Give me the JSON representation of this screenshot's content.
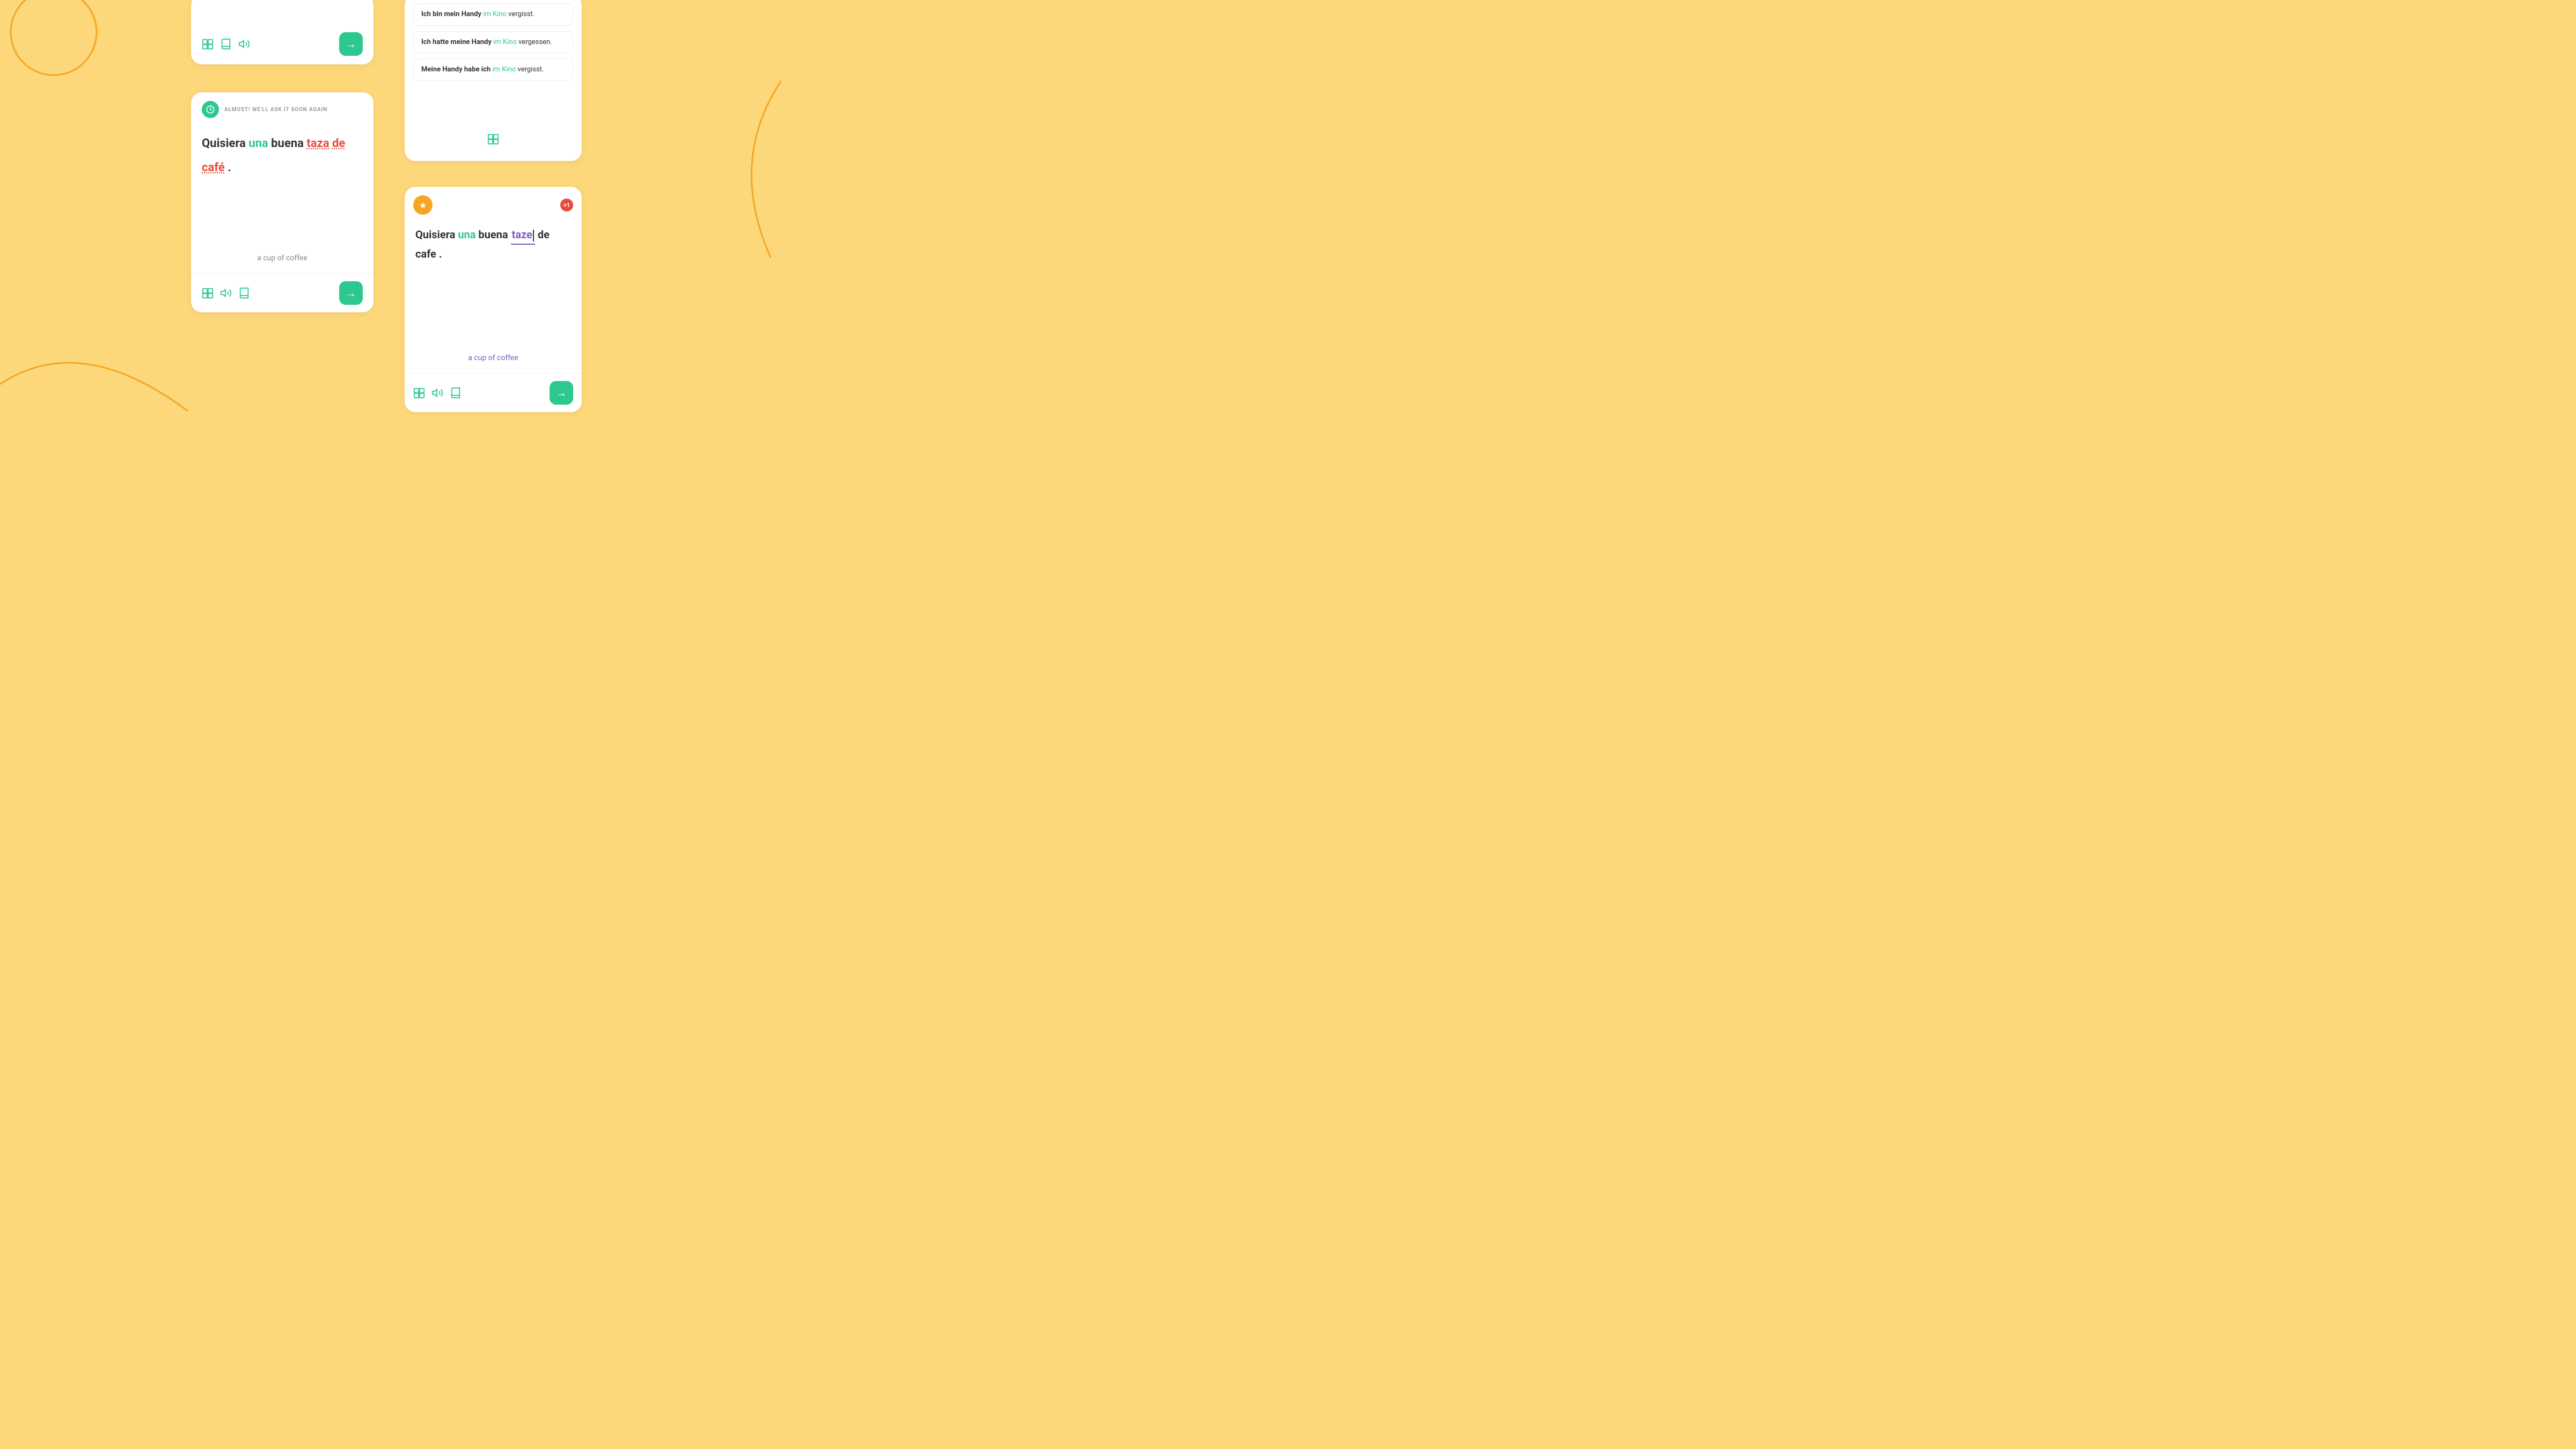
{
  "background_color": "#FDD87A",
  "accent_color": "#F5A623",
  "green_color": "#2DC88F",
  "red_color": "#E74C3C",
  "purple_color": "#7C5CBF",
  "card_top_left": {
    "footer_icons": [
      "translate-icon",
      "volume-icon",
      "book-icon"
    ],
    "arrow_label": "→"
  },
  "card_mid_left": {
    "banner_text": "ALMOST! WE'LL ASK IT SOON AGAIN",
    "sentence_parts": [
      {
        "text": "Quisiera",
        "style": "normal"
      },
      {
        "text": "una",
        "style": "green"
      },
      {
        "text": "buena",
        "style": "normal"
      },
      {
        "text": "taza",
        "style": "red-underline"
      },
      {
        "text": "de",
        "style": "red-underline"
      },
      {
        "text": "café",
        "style": "red-underline"
      },
      {
        "text": ".",
        "style": "normal"
      }
    ],
    "translation": "a cup of coffee",
    "footer_icons": [
      "translate-icon",
      "volume-icon",
      "book-icon"
    ],
    "arrow_label": "→"
  },
  "card_top_right": {
    "sentences": [
      {
        "bold_part": "Ich bin mein Handy",
        "rest": " im Kino vergisst."
      },
      {
        "bold_part": "Ich hatte meine Handy",
        "rest": " im Kino vergessen."
      },
      {
        "bold_part": "Meine Handy habe ich",
        "rest": " im Kino vergisst."
      }
    ],
    "footer_icon": "translate-icon"
  },
  "card_bot_right": {
    "star_icon": "★",
    "plus_count": "+1",
    "sentence_parts": [
      {
        "text": "Quisiera",
        "style": "normal"
      },
      {
        "text": "una",
        "style": "green"
      },
      {
        "text": "buena",
        "style": "normal"
      },
      {
        "text": "taze",
        "style": "typed"
      },
      {
        "text": "de",
        "style": "normal"
      },
      {
        "text": "cafe",
        "style": "normal"
      },
      {
        "text": ".",
        "style": "normal"
      }
    ],
    "translation": "a cup of coffee",
    "footer_icons": [
      "translate-icon",
      "volume-icon",
      "book-icon"
    ],
    "arrow_label": "→"
  }
}
